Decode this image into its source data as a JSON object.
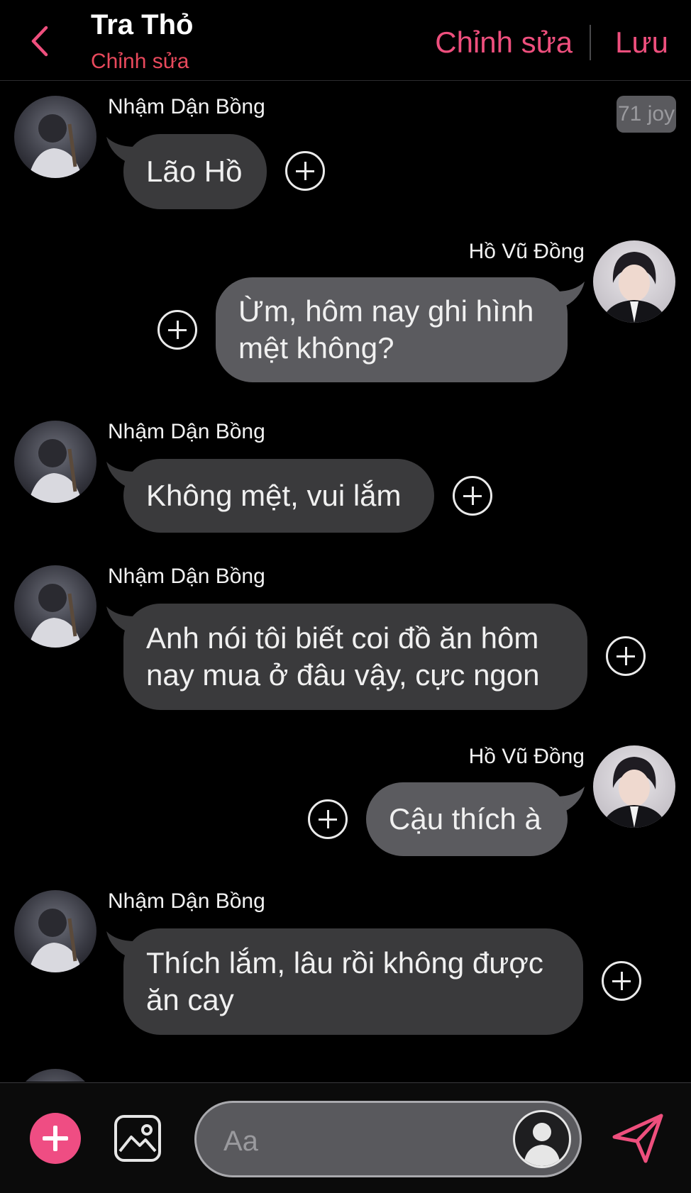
{
  "header": {
    "title": "Tra Thỏ",
    "subtitle": "Chỉnh sửa",
    "edit_label": "Chỉnh sửa",
    "save_label": "Lưu"
  },
  "badge": "71 joy",
  "messages": [
    {
      "sender": "Nhậm Dận Bồng",
      "text": "Lão Hồ",
      "side": "left"
    },
    {
      "sender": "Hồ Vũ Đồng",
      "text": "Ừm, hôm nay ghi hình\nmệt không?",
      "side": "right"
    },
    {
      "sender": "Nhậm Dận Bồng",
      "text": "Không mệt, vui lắm",
      "side": "left"
    },
    {
      "sender": "Nhậm Dận Bồng",
      "text": "Anh nói tôi biết coi đồ ăn hôm\nnay mua ở đâu vậy, cực ngon",
      "side": "left"
    },
    {
      "sender": "Hồ Vũ Đồng",
      "text": "Cậu thích à",
      "side": "right"
    },
    {
      "sender": "Nhậm Dận Bồng",
      "text": "Thích lắm, lâu rồi không được\năn cay",
      "side": "left"
    },
    {
      "sender": "Nhậm Dận Bồng",
      "text": "",
      "side": "left"
    }
  ],
  "input": {
    "placeholder": "Aa"
  },
  "colors": {
    "accent": "#ee4f7d",
    "subtitle": "#e8495c",
    "bubble_left": "#3a3a3c",
    "bubble_right": "#5b5b5f",
    "background": "#000000"
  },
  "icons": {
    "back": "chevron-left-icon",
    "add": "plus-icon",
    "image": "image-icon",
    "send": "send-icon",
    "message_action": "plus-circle-icon"
  }
}
